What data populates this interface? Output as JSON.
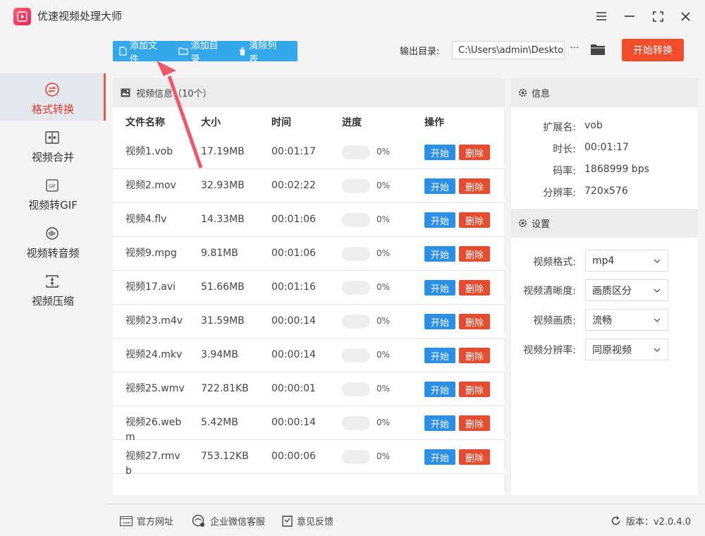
{
  "app": {
    "title": "优速视频处理大师",
    "brand_color": "#e8264f"
  },
  "window_controls": [
    "menu-icon",
    "minimize-icon",
    "maximize-icon",
    "close-icon"
  ],
  "sidebar": {
    "items": [
      {
        "label": "格式转换",
        "icon": "convert-icon",
        "active": true
      },
      {
        "label": "视频合并",
        "icon": "merge-icon"
      },
      {
        "label": "视频转GIF",
        "icon": "gif-icon"
      },
      {
        "label": "视频转音频",
        "icon": "audio-icon"
      },
      {
        "label": "视频压缩",
        "icon": "compress-icon"
      }
    ]
  },
  "toolbar": {
    "add_file": "添加文件",
    "add_dir": "添加目录",
    "clear_list": "清除列表",
    "output_label": "输出目录:",
    "output_path": "C:\\Users\\admin\\Deskto",
    "more": "···",
    "start_convert": "开始转换",
    "accent": "#34a8ea",
    "start_color": "#f24d2b"
  },
  "file_panel": {
    "title": "视频信息（10个）",
    "columns": [
      "文件名称",
      "大小",
      "时间",
      "进度",
      "操作"
    ],
    "start_label": "开始",
    "delete_label": "删除",
    "rows": [
      {
        "name": "视频1.vob",
        "size": "17.19MB",
        "time": "00:01:17",
        "progress": 0,
        "pct": "0%"
      },
      {
        "name": "视频2.mov",
        "size": "32.93MB",
        "time": "00:02:22",
        "progress": 0,
        "pct": "0%"
      },
      {
        "name": "视频4.flv",
        "size": "14.33MB",
        "time": "00:01:06",
        "progress": 0,
        "pct": "0%"
      },
      {
        "name": "视频9.mpg",
        "size": "9.81MB",
        "time": "00:01:06",
        "progress": 0,
        "pct": "0%"
      },
      {
        "name": "视频17.avi",
        "size": "51.66MB",
        "time": "00:01:16",
        "progress": 0,
        "pct": "0%"
      },
      {
        "name": "视频23.m4v",
        "size": "31.59MB",
        "time": "00:00:14",
        "progress": 0,
        "pct": "0%"
      },
      {
        "name": "视频24.mkv",
        "size": "3.94MB",
        "time": "00:00:14",
        "progress": 0,
        "pct": "0%"
      },
      {
        "name": "视频25.wmv",
        "size": "722.81KB",
        "time": "00:00:01",
        "progress": 0,
        "pct": "0%"
      },
      {
        "name": "视频26.webm",
        "size": "5.42MB",
        "time": "00:00:14",
        "progress": 0,
        "pct": "0%"
      },
      {
        "name": "视频27.rmvb",
        "size": "753.12KB",
        "time": "00:00:06",
        "progress": 0,
        "pct": "0%"
      }
    ]
  },
  "info_panel": {
    "title": "信息",
    "items": [
      {
        "label": "扩展名:",
        "value": "vob"
      },
      {
        "label": "时长:",
        "value": "00:01:17"
      },
      {
        "label": "码率:",
        "value": "1868999 bps"
      },
      {
        "label": "分辨率:",
        "value": "720x576"
      }
    ]
  },
  "settings_panel": {
    "title": "设置",
    "items": [
      {
        "label": "视频格式:",
        "value": "mp4"
      },
      {
        "label": "视频清晰度:",
        "value": "画质区分"
      },
      {
        "label": "视频画质:",
        "value": "流畅"
      },
      {
        "label": "视频分辨率:",
        "value": "同原视频"
      }
    ]
  },
  "footer": {
    "website": "官方网址",
    "wechat": "企业微信客服",
    "feedback": "意见反馈",
    "version": "版本：v2.0.4.0"
  }
}
